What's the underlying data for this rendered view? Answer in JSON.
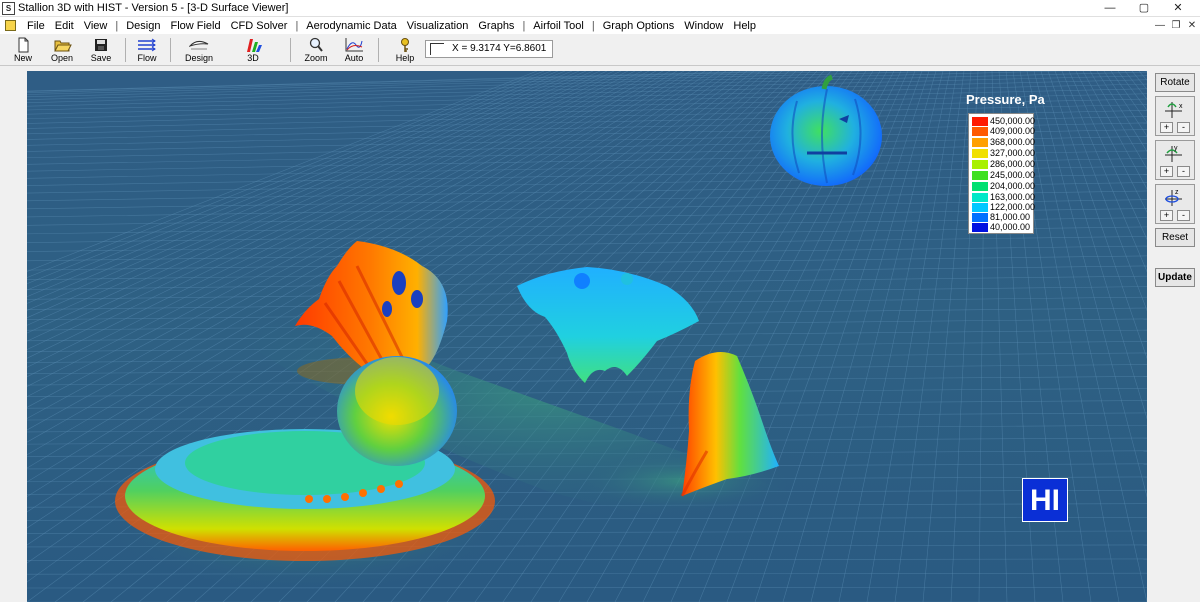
{
  "window": {
    "title": "Stallion 3D with HIST - Version 5 - [3-D Surface Viewer]",
    "controls": {
      "minimize": "—",
      "maximize": "▢",
      "close": "✕"
    }
  },
  "menu": {
    "items": [
      "File",
      "Edit",
      "View",
      "Design",
      "Flow Field",
      "CFD Solver",
      "Aerodynamic Data",
      "Visualization",
      "Graphs",
      "Airfoil Tool",
      "Graph Options",
      "Window",
      "Help"
    ],
    "separator": "|",
    "mdi_controls": {
      "minimize": "—",
      "restore": "❐",
      "close": "✕"
    }
  },
  "toolbar": {
    "buttons": [
      {
        "label": "New",
        "icon": "new-file-icon"
      },
      {
        "label": "Open",
        "icon": "open-folder-icon"
      },
      {
        "label": "Save",
        "icon": "save-disk-icon"
      },
      {
        "label": "Flow",
        "icon": "flow-lines-icon"
      },
      {
        "label": "Design",
        "icon": "design-airfoil-icon"
      },
      {
        "label": "3D",
        "icon": "3d-view-icon"
      },
      {
        "label": "Zoom",
        "icon": "zoom-magnifier-icon"
      },
      {
        "label": "Auto",
        "icon": "auto-scale-graph-icon"
      },
      {
        "label": "Help",
        "icon": "help-key-icon"
      }
    ],
    "coordinates": "X = 9.3174  Y=6.8601"
  },
  "legend": {
    "title": "Pressure, Pa",
    "entries": [
      {
        "value": "450,000.00",
        "color": "#ff1a00"
      },
      {
        "value": "409,000.00",
        "color": "#ff5a00"
      },
      {
        "value": "368,000.00",
        "color": "#ffa000"
      },
      {
        "value": "327,000.00",
        "color": "#f0e000"
      },
      {
        "value": "286,000.00",
        "color": "#a8f000"
      },
      {
        "value": "245,000.00",
        "color": "#40e020"
      },
      {
        "value": "204,000.00",
        "color": "#00e070"
      },
      {
        "value": "163,000.00",
        "color": "#00e8c8"
      },
      {
        "value": "122,000.00",
        "color": "#00c8ff"
      },
      {
        "value": "81,000.00",
        "color": "#0070ff"
      },
      {
        "value": "40,000.00",
        "color": "#0010e0"
      }
    ]
  },
  "badge": {
    "text": "HI"
  },
  "right_panel": {
    "rotate_label": "Rotate",
    "axes": [
      {
        "axis": "x",
        "plus": "+",
        "minus": "-"
      },
      {
        "axis": "y",
        "plus": "+",
        "minus": "-"
      },
      {
        "axis": "z",
        "plus": "+",
        "minus": "-"
      }
    ],
    "reset_label": "Reset",
    "update_label": "Update"
  },
  "colors": {
    "viewport_bg": "#2d5c86",
    "grid_line": "#5e8fb3",
    "high_pressure": "#ff1a00",
    "low_pressure": "#0010e0"
  }
}
